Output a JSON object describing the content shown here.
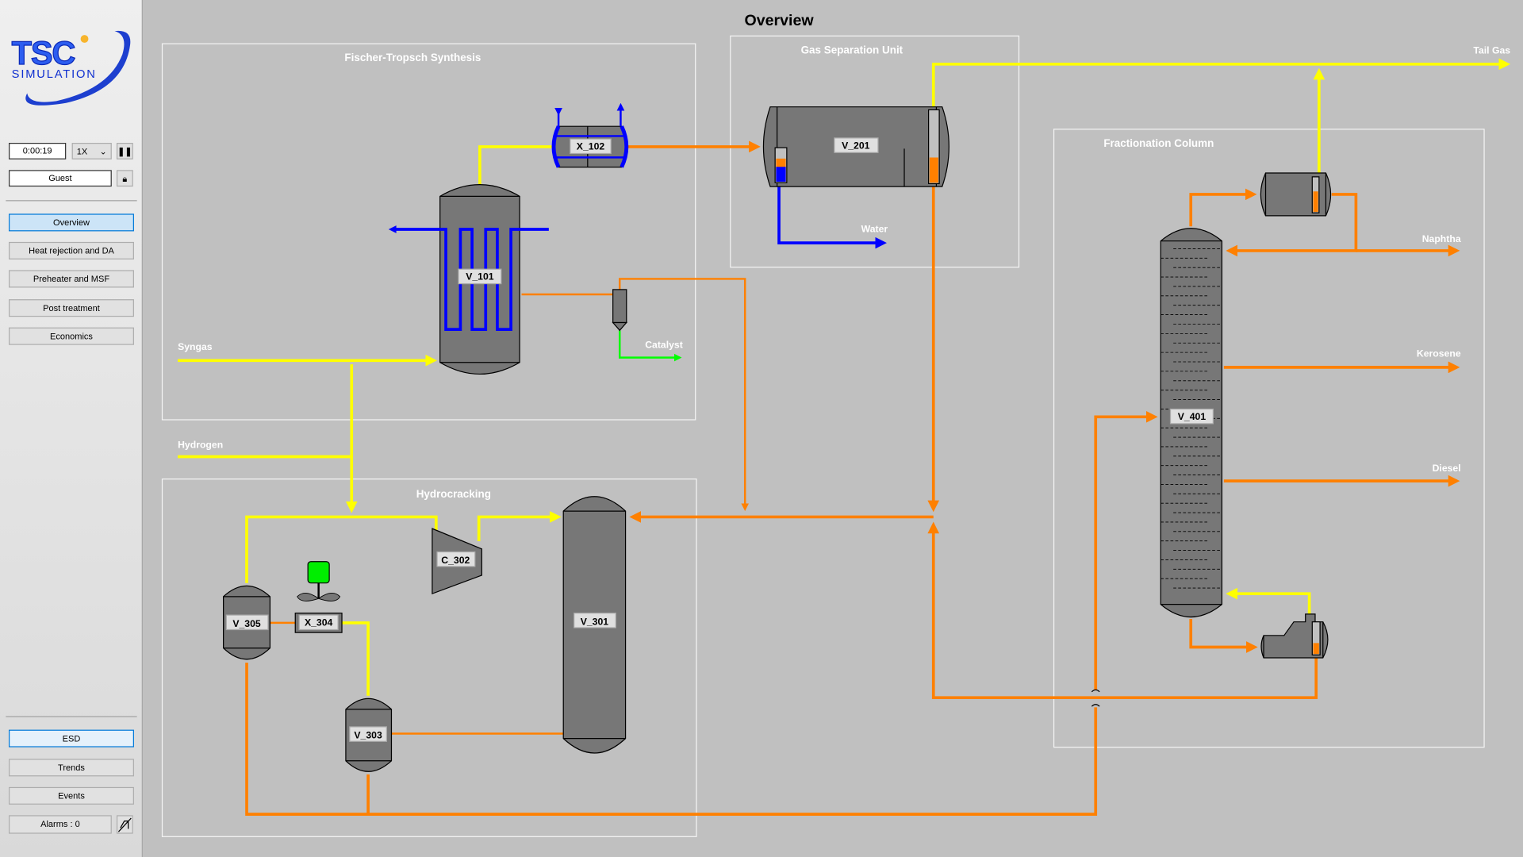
{
  "sidebar": {
    "logo_text": "TSC SIMULATION",
    "time": "0:00:19",
    "speed": "1X",
    "user": "Guest",
    "nav": [
      "Overview",
      "Heat rejection and DA",
      "Preheater and MSF",
      "Post treatment",
      "Economics"
    ],
    "active_nav": "Overview",
    "bottom": {
      "esd": "ESD",
      "trends": "Trends",
      "events": "Events",
      "alarms": "Alarms : 0"
    }
  },
  "header": {
    "title": "Overview"
  },
  "sections": {
    "ft": "Fischer-Tropsch Synthesis",
    "gsu": "Gas Separation Unit",
    "frac": "Fractionation Column",
    "hc": "Hydrocracking"
  },
  "streams": {
    "syngas": "Syngas",
    "hydrogen": "Hydrogen",
    "catalyst": "Catalyst",
    "water": "Water",
    "tail_gas": "Tail Gas",
    "naphtha": "Naphtha",
    "kerosene": "Kerosene",
    "diesel": "Diesel"
  },
  "equipment": {
    "v101": "V_101",
    "x102": "X_102",
    "v201": "V_201",
    "v401": "V_401",
    "v301": "V_301",
    "c302": "C_302",
    "v303": "V_303",
    "x304": "X_304",
    "v305": "V_305"
  },
  "levels": {
    "v201_left_total": 0.7,
    "v201_left_water": 0.45,
    "v201_right": 0.35,
    "v401_condenser": 0.6,
    "v401_reboiler": 0.35
  },
  "colors": {
    "gas": "#ffff00",
    "liquid": "#ff8000",
    "water": "#0000ff",
    "catalyst": "#00ff00",
    "vessel": "#777777",
    "background": "#c0c0c0"
  }
}
